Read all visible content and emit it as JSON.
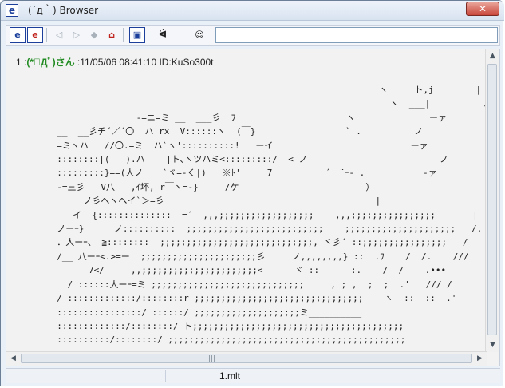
{
  "window": {
    "title": "(´д｀) Browser",
    "app_icon_glyph": "e",
    "close_glyph": "✕"
  },
  "toolbar": {
    "buttons": [
      {
        "icon": "browser-e-icon",
        "glyph": "e"
      },
      {
        "icon": "browser-e-red-icon",
        "glyph": "e"
      },
      {
        "icon": "back-icon",
        "glyph": "◁"
      },
      {
        "icon": "forward-icon",
        "glyph": "▷"
      },
      {
        "icon": "stop-icon",
        "glyph": "◆"
      },
      {
        "icon": "home-icon",
        "glyph": "⌂"
      },
      {
        "icon": "window-icon",
        "glyph": "▣"
      },
      {
        "icon": "face-icon",
        "glyph": "ᐛ"
      },
      {
        "icon": "search-face-icon",
        "glyph": "☺"
      }
    ],
    "address_value": ""
  },
  "post": {
    "number": "1",
    "name": "(*ﾟДﾟ)さん",
    "datetime": "11/05/06 08:41:10",
    "id": "ID:KuSo300t"
  },
  "ascii_art": "                                                               ヽ     ト,j        |\n                                                                 ヽ  ___|          ノ|\n                 -=ニ=ミ __  ___彡  ﾌ                     ヽ              ーァ\n  __  __彡チ´／´〇  ハ rx  V::::::ヽ  (￣}                 ` .          ノ\n  =ミヽハ   //〇.=ミ  ハ`ヽ'::::::::::!   ーイ                          ーァ\n  ::::::::|(   ).ハ  __|ト､ヽツハミ<:::::::::/  < ノ           _____         ノ\n  :::::::::}==(人ノ￣  `ヾ=-く|)   ※ﾄ'     7          ´￣¨ｰ- .           -ァ\n  -=三彡   V八   ,ｲ坏, r￣ヽ=-}_____/ケ__________________      ）\n       ノ彡へヽへイ`＞=彡                                        |\n  __ イ  {::::::::::::::  =´  ,,,;;;;;;;;;;;;;;;;;;    ,,,;;;;;;;;;;;;;;;;       |\n  ノーｰ}    ￣ノ::::::::::  ;;;;;;;;;;;;;;;;;;;;;;;;;;    ;;;;;;;;;;;;;;;;;;;;;   /.   ,\n  ．人ーｰ、 ≧::::::::  ;;;;;;;;;;;;;;;;;;;;;;;;;;;;;, ヾ彡´ ::;;;;;;;;;;;;;;;;   /     ッ\n  /__ 八ーｰ<.>=ー  ;;;;;;;;;;;;;;;;;;;;;;彡     ノ,,,,,,,,} ::  .ﾌ    /  /.    ///\n        7</     ,,;;;;;;;;;;;;;;;;;;;;;;<      ヾ ::      :.    /  /    .•••\n    / ::::::人ーｰ=ミ ;;;;;;;;;;;;;;;;;;;;;;;;;;;;;     , ; ,  ;  ;  .'   /// /\n  / :::::::::::::/::::::::r ;;;;;;;;;;;;;;;;;;;;;;;;;;;;;;;;    ヽ  ::  ::  .'      /\n  ::::::::::::::::/ ::::::/ ;;;;;;;;;;;;;;;;;;;;ミ__________\n  :::::::::::::/::::::::/ ト;;;;;;;;;;;;;;;;;;;;;;;;;;;;;;;;;;;;;;;;\n  ::::::::::/::::::::/ ;;;;;;;;;;;;;;;;;;;;;;;;;;;;;;;;;;;;;;;;;;;;;",
  "status": {
    "filename": "1.mlt"
  }
}
